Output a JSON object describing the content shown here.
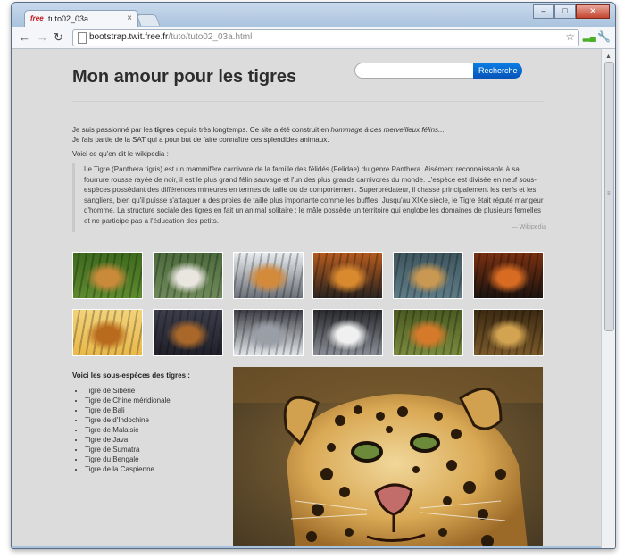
{
  "window": {
    "tab_title": "tuto02_03a",
    "favicon_text": "free",
    "url_host": "bootstrap.twit.free.fr",
    "url_path": "/tuto/tuto02_03a.html"
  },
  "page": {
    "title": "Mon amour pour les tigres",
    "search": {
      "placeholder": "",
      "button_label": "Recherche"
    },
    "intro": {
      "line1_a": "Je suis passionné par les ",
      "line1_bold": "tigres",
      "line1_b": " depuis très longtemps. Ce site a été construit en ",
      "line1_italic": "hommage à ces merveilleux félins...",
      "line2": "Je fais partie de la SAT qui a pour but de faire connaître ces splendides animaux."
    },
    "wiki_caption": "Voici ce qu'en dit le wikipedia :",
    "quote": {
      "text": "Le Tigre (Panthera tigris) est un mammifère carnivore de la famille des félidés (Felidae) du genre Panthera. Aisément reconnaissable à sa fourrure rousse rayée de noir, il est le plus grand félin sauvage et l'un des plus grands carnivores du monde. L'espèce est divisée en neuf sous-espèces possédant des différences mineures en termes de taille ou de comportement. Superprédateur, il chasse principalement les cerfs et les sangliers, bien qu'il puisse s'attaquer à des proies de taille plus importante comme les buffles. Jusqu'au XIXe siècle, le Tigre était réputé mangeur d'homme. La structure sociale des tigres en fait un animal solitaire ; le mâle possède un territoire qui englobe les domaines de plusieurs femelles et ne participe pas à l'éducation des petits.",
      "source": "— Wikipedia"
    },
    "gallery": [
      {
        "name": "tiger-lying-grass",
        "colors": [
          "#5e8a2f",
          "#c98a3a",
          "#3e6a1e"
        ]
      },
      {
        "name": "white-tiger-walking",
        "colors": [
          "#6f8a5a",
          "#e9e6df",
          "#4c6b3c"
        ]
      },
      {
        "name": "tiger-on-snow-rocks",
        "colors": [
          "#6b6f77",
          "#d38a3b",
          "#e8ecef"
        ]
      },
      {
        "name": "tiger-standing-dark",
        "colors": [
          "#2a2420",
          "#d9892e",
          "#b65b1e"
        ]
      },
      {
        "name": "tiger-at-water",
        "colors": [
          "#5e7b86",
          "#c99852",
          "#3f565e"
        ]
      },
      {
        "name": "tiger-face-closeup",
        "colors": [
          "#1b1410",
          "#d76b22",
          "#7a3010"
        ]
      },
      {
        "name": "tiger-cub-sunlight",
        "colors": [
          "#e9b84a",
          "#b86a1d",
          "#f2d27a"
        ]
      },
      {
        "name": "tiger-cub-shadow",
        "colors": [
          "#20202a",
          "#a9672a",
          "#3c3d4a"
        ]
      },
      {
        "name": "white-tiger-snow",
        "colors": [
          "#e2e6ea",
          "#9a9ea6",
          "#3c3d44"
        ]
      },
      {
        "name": "white-tiger-face",
        "colors": [
          "#8a8e96",
          "#f0f0f0",
          "#2a2a2e"
        ]
      },
      {
        "name": "tiger-roaring",
        "colors": [
          "#7a8b3e",
          "#d47a2a",
          "#4b5a22"
        ]
      },
      {
        "name": "leopard-resting",
        "colors": [
          "#7b5a2a",
          "#d2a351",
          "#3c2a12"
        ]
      }
    ],
    "subspecies": {
      "title": "Voici les sous-espèces des tigres :",
      "items": [
        "Tigre de Sibérie",
        "Tigre de Chine méridionale",
        "Tigre de Bali",
        "Tigre de d'Indochine",
        "Tigre de Malaisie",
        "Tigre de Java",
        "Tigre de Sumatra",
        "Tigre du Bengale",
        "Tigre de la Caspienne"
      ]
    }
  },
  "colors": {
    "page_background": "#dcdcdc",
    "search_button": "#0a6fd8",
    "frame": "#a9c2dd"
  }
}
